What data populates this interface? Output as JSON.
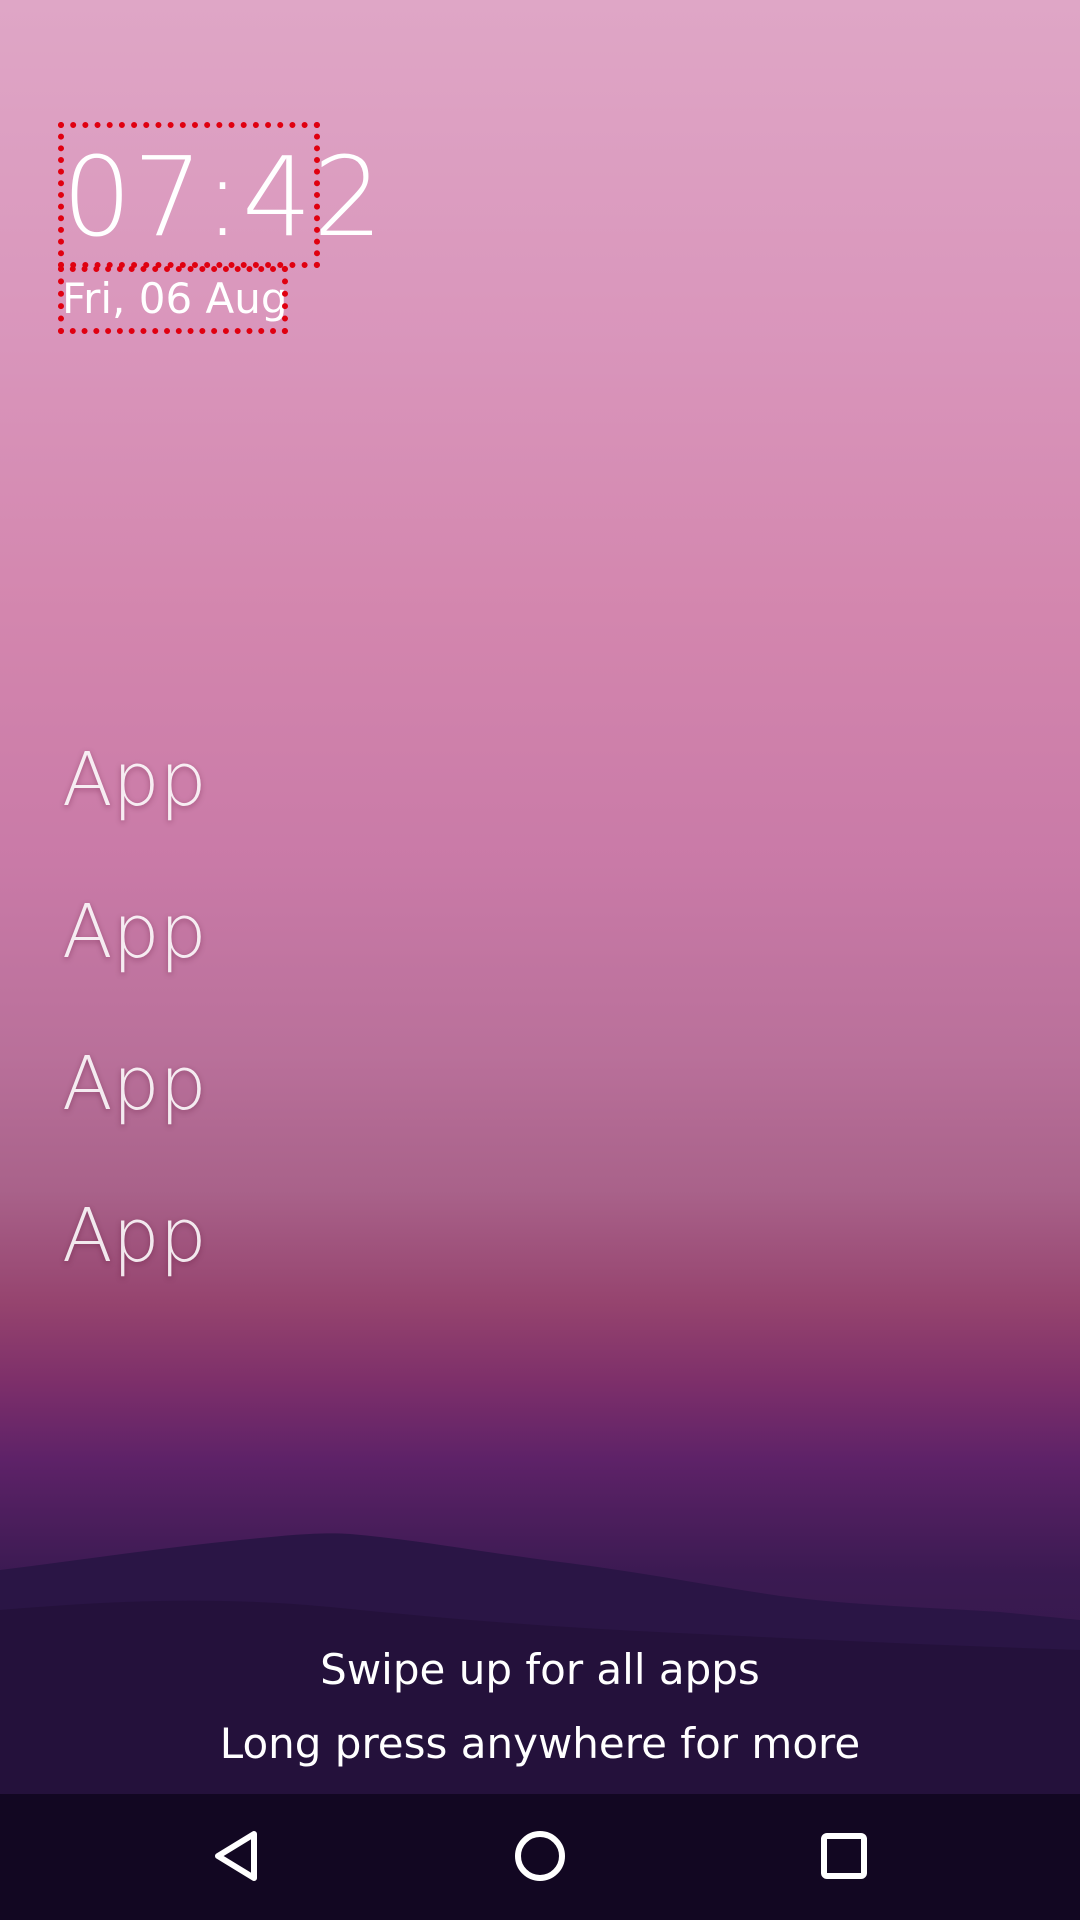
{
  "home": {
    "clock": "07:42",
    "date": "Fri, 06 Aug"
  },
  "apps": [
    {
      "label": "App"
    },
    {
      "label": "App"
    },
    {
      "label": "App"
    },
    {
      "label": "App"
    }
  ],
  "hints": {
    "swipe": "Swipe up for all apps",
    "long_press": "Long press anywhere for more"
  },
  "navbar": {
    "buttons": [
      {
        "icon": "back-triangle-icon"
      },
      {
        "icon": "home-circle-icon"
      },
      {
        "icon": "recents-square-icon"
      }
    ]
  },
  "colors": {
    "highlight": "#e00010",
    "navbar": "#120722"
  }
}
